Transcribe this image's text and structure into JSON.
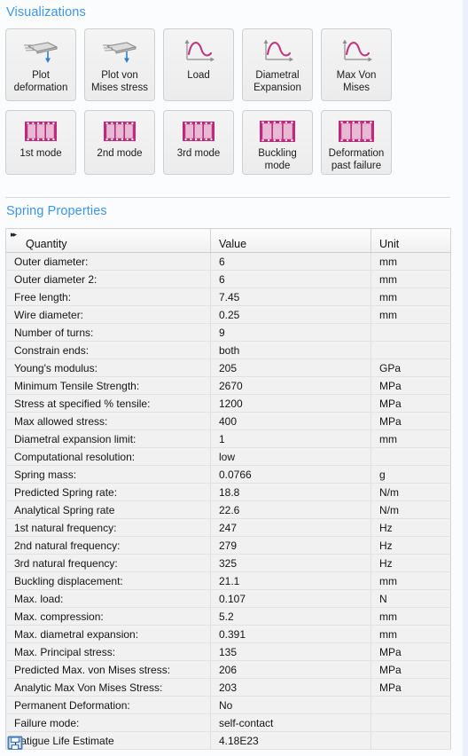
{
  "colors": {
    "heading": "#3d95e8",
    "curve": "#c2357f",
    "film_border": "#bd2a7b",
    "film_fill": "#e7b9d4",
    "arrow": "#2f7fd1",
    "save_icon": "#4a7ebb"
  },
  "visualizations": {
    "title": "Visualizations",
    "buttons_row1": [
      {
        "label": "Plot\ndeformation",
        "icon": "beam-deformation-icon"
      },
      {
        "label": "Plot von\nMises stress",
        "icon": "beam-deformation-icon"
      },
      {
        "label": "Load",
        "icon": "curve-plot-icon"
      },
      {
        "label": "Diametral\nExpansion",
        "icon": "curve-plot-icon"
      },
      {
        "label": "Max Von\nMises",
        "icon": "curve-plot-icon"
      }
    ],
    "buttons_row2": [
      {
        "label": "1st mode",
        "icon": "film-strip-icon"
      },
      {
        "label": "2nd mode",
        "icon": "film-strip-icon"
      },
      {
        "label": "3rd mode",
        "icon": "film-strip-icon"
      },
      {
        "label": "Buckling\nmode",
        "icon": "film-strip-icon"
      },
      {
        "label": "Deformation\npast failure",
        "icon": "film-strip-icon"
      }
    ]
  },
  "spring_properties": {
    "title": "Spring Properties",
    "columns": [
      "Quantity",
      "Value",
      "Unit"
    ],
    "rows": [
      {
        "quantity": "Outer diameter:",
        "value": "6",
        "unit": "mm"
      },
      {
        "quantity": "Outer diameter 2:",
        "value": "6",
        "unit": "mm"
      },
      {
        "quantity": "Free length:",
        "value": "7.45",
        "unit": "mm"
      },
      {
        "quantity": "Wire diameter:",
        "value": "0.25",
        "unit": "mm"
      },
      {
        "quantity": "Number of turns:",
        "value": "9",
        "unit": ""
      },
      {
        "quantity": "Constrain ends:",
        "value": "both",
        "unit": ""
      },
      {
        "quantity": "Young's modulus:",
        "value": "205",
        "unit": "GPa"
      },
      {
        "quantity": "Minimum Tensile Strength:",
        "value": "2670",
        "unit": "MPa"
      },
      {
        "quantity": "Stress at specified % tensile:",
        "value": "1200",
        "unit": "MPa"
      },
      {
        "quantity": "Max allowed stress:",
        "value": "400",
        "unit": "MPa"
      },
      {
        "quantity": "Diametral expansion limit:",
        "value": "1",
        "unit": "mm"
      },
      {
        "quantity": "Computational resolution:",
        "value": "low",
        "unit": ""
      },
      {
        "quantity": "Spring mass:",
        "value": "0.0766",
        "unit": "g"
      },
      {
        "quantity": "Predicted Spring rate:",
        "value": "18.8",
        "unit": "N/m"
      },
      {
        "quantity": "Analytical Spring rate",
        "value": "22.6",
        "unit": "N/m"
      },
      {
        "quantity": "1st natural frequency:",
        "value": "247",
        "unit": "Hz"
      },
      {
        "quantity": "2nd natural frequency:",
        "value": "279",
        "unit": "Hz"
      },
      {
        "quantity": "3rd natural frequency:",
        "value": "325",
        "unit": "Hz"
      },
      {
        "quantity": "Buckling displacement:",
        "value": "21.1",
        "unit": "mm"
      },
      {
        "quantity": "Max. load:",
        "value": "0.107",
        "unit": "N"
      },
      {
        "quantity": "Max. compression:",
        "value": "5.2",
        "unit": "mm"
      },
      {
        "quantity": "Max. diametral expansion:",
        "value": "0.391",
        "unit": "mm"
      },
      {
        "quantity": "Max. Principal stress:",
        "value": "135",
        "unit": "MPa"
      },
      {
        "quantity": "Predicted Max. von Mises stress:",
        "value": "206",
        "unit": "MPa"
      },
      {
        "quantity": "Analytic Max Von Mises Stress:",
        "value": "203",
        "unit": "MPa"
      },
      {
        "quantity": "Permanent Deformation:",
        "value": "No",
        "unit": ""
      },
      {
        "quantity": "Failure mode:",
        "value": "self-contact",
        "unit": ""
      },
      {
        "quantity": "Fatigue Life Estimate",
        "value": "4.18E23",
        "unit": ""
      }
    ]
  },
  "footer": {
    "save_icon": "save-floppy-icon"
  }
}
